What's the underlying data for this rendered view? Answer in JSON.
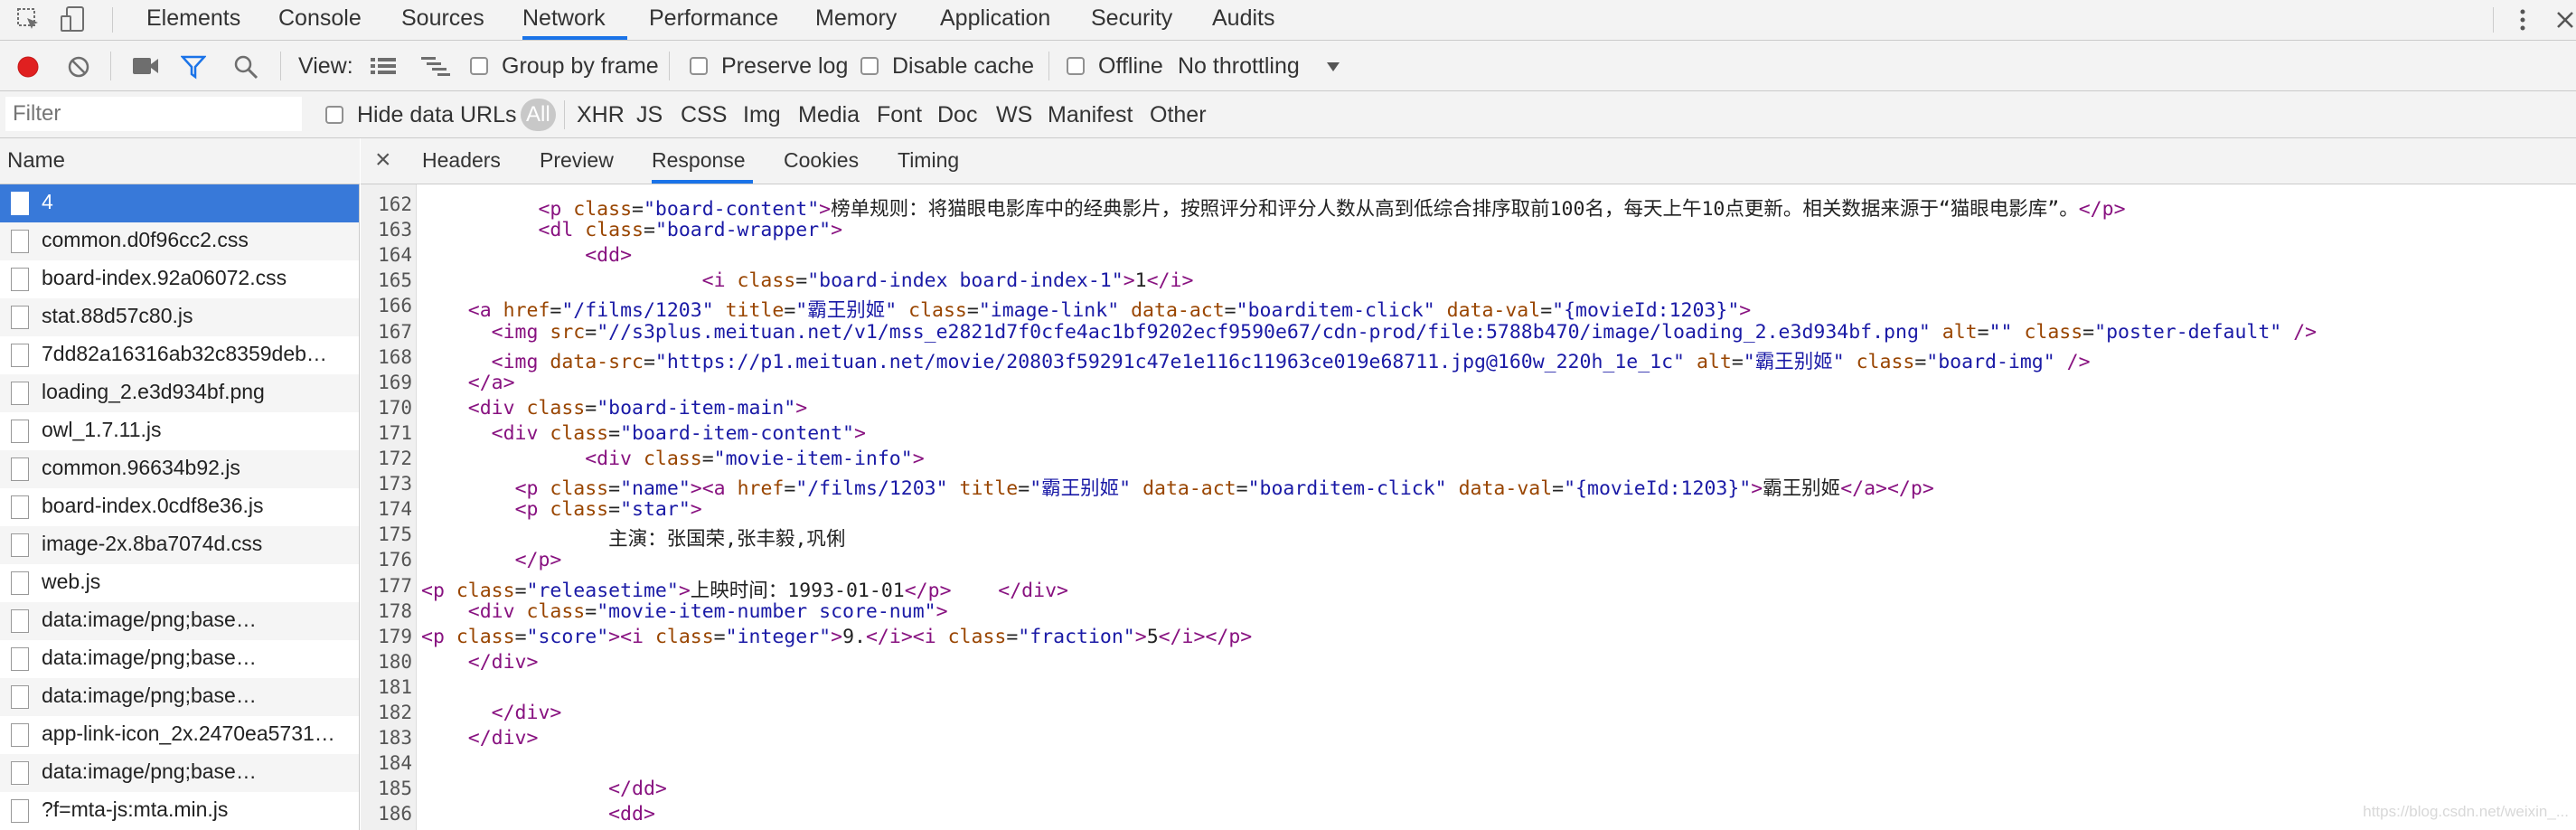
{
  "tabbar": {
    "tabs": [
      "Elements",
      "Console",
      "Sources",
      "Network",
      "Performance",
      "Memory",
      "Application",
      "Security",
      "Audits"
    ],
    "active": "Network"
  },
  "toolbar": {
    "view_label": "View:",
    "group_by_frame": "Group by frame",
    "preserve_log": "Preserve log",
    "disable_cache": "Disable cache",
    "offline": "Offline",
    "throttling": "No throttling"
  },
  "filterbar": {
    "placeholder": "Filter",
    "hide_data_urls": "Hide data URLs",
    "types": [
      "All",
      "XHR",
      "JS",
      "CSS",
      "Img",
      "Media",
      "Font",
      "Doc",
      "WS",
      "Manifest",
      "Other"
    ]
  },
  "name_panel": {
    "header": "Name",
    "files": [
      "4",
      "common.d0f96cc2.css",
      "board-index.92a06072.css",
      "stat.88d57c80.js",
      "7dd82a16316ab32c8359deb…",
      "loading_2.e3d934bf.png",
      "owl_1.7.11.js",
      "common.96634b92.js",
      "board-index.0cdf8e36.js",
      "image-2x.8ba7074d.css",
      "web.js",
      "data:image/png;base…",
      "data:image/png;base…",
      "data:image/png;base…",
      "app-link-icon_2x.2470ea5731…",
      "data:image/png;base…",
      "?f=mta-js:mta.min.js"
    ]
  },
  "detail": {
    "close": "×",
    "tabs": [
      "Headers",
      "Preview",
      "Response",
      "Cookies",
      "Timing"
    ],
    "active": "Response"
  },
  "code": {
    "line_numbers": [
      "162",
      "163",
      "164",
      "165",
      "166",
      "167",
      "168",
      "169",
      "170",
      "171",
      "172",
      "173",
      "174",
      "175",
      "176",
      "177",
      "178",
      "179",
      "180",
      "181",
      "182",
      "183",
      "184",
      "185",
      "186"
    ],
    "lines": [
      "          <p class=\"board-content\">榜单规则：将猫眼电影库中的经典影片，按照评分和评分人数从高到低综合排序取前100名，每天上午10点更新。相关数据来源于“猫眼电影库”。</p>",
      "          <dl class=\"board-wrapper\">",
      "              <dd>",
      "                        <i class=\"board-index board-index-1\">1</i>",
      "    <a href=\"/films/1203\" title=\"霸王别姬\" class=\"image-link\" data-act=\"boarditem-click\" data-val=\"{movieId:1203}\">",
      "      <img src=\"//s3plus.meituan.net/v1/mss_e2821d7f0cfe4ac1bf9202ecf9590e67/cdn-prod/file:5788b470/image/loading_2.e3d934bf.png\" alt=\"\" class=\"poster-default\" />",
      "      <img data-src=\"https://p1.meituan.net/movie/20803f59291c47e1e116c11963ce019e68711.jpg@160w_220h_1e_1c\" alt=\"霸王别姬\" class=\"board-img\" />",
      "    </a>",
      "    <div class=\"board-item-main\">",
      "      <div class=\"board-item-content\">",
      "              <div class=\"movie-item-info\">",
      "        <p class=\"name\"><a href=\"/films/1203\" title=\"霸王别姬\" data-act=\"boarditem-click\" data-val=\"{movieId:1203}\">霸王别姬</a></p>",
      "        <p class=\"star\">",
      "                主演：张国荣,张丰毅,巩俐",
      "        </p>",
      "<p class=\"releasetime\">上映时间：1993-01-01</p>    </div>",
      "    <div class=\"movie-item-number score-num\">",
      "<p class=\"score\"><i class=\"integer\">9.</i><i class=\"fraction\">5</i></p>",
      "    </div>",
      "",
      "      </div>",
      "    </div>",
      "",
      "                </dd>",
      "                <dd>"
    ]
  },
  "watermark": "https://blog.csdn.net/weixin_..."
}
